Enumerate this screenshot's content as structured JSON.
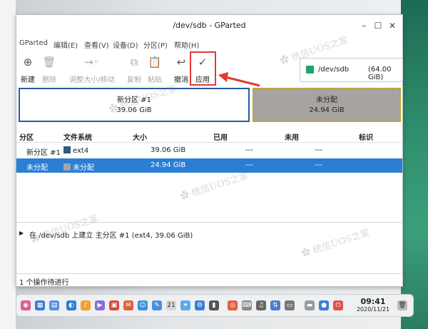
{
  "window": {
    "title": "/dev/sdb - GParted"
  },
  "menubar": [
    "GParted",
    "编辑(E)",
    "查看(V)",
    "设备(D)",
    "分区(P)",
    "帮助(H)"
  ],
  "toolbar": {
    "new": "新建",
    "delete": "删除",
    "resize": "调整大小/移动",
    "copy": "复制",
    "paste": "粘贴",
    "undo": "撤消",
    "apply": "应用"
  },
  "device": {
    "path": "/dev/sdb",
    "size": "(64.00 GiB)"
  },
  "partition_map": [
    {
      "name": "新分区 #1",
      "size": "39.06 GiB"
    },
    {
      "name": "未分配",
      "size": "24.94 GiB"
    }
  ],
  "table": {
    "headers": [
      "分区",
      "文件系统",
      "大小",
      "已用",
      "未用",
      "标识"
    ],
    "rows": [
      {
        "partition": "新分区 #1",
        "fs": "ext4",
        "fs_color": "#315a7e",
        "size": "39.06 GiB",
        "used": "---",
        "unused": "---",
        "flags": ""
      },
      {
        "partition": "未分配",
        "fs": "未分配",
        "fs_color": "#a5a5a5",
        "size": "24.94 GiB",
        "used": "---",
        "unused": "---",
        "flags": ""
      }
    ]
  },
  "operations": [
    "在 /dev/sdb 上建立 主分区 #1 (ext4, 39.06 GiB)"
  ],
  "status": "1 个操作待进行",
  "taskbar": {
    "time": "09:41",
    "date": "2020/11/21"
  },
  "watermark": "统信UOS之家 www.xtuos.com",
  "colors": {
    "highlight": "#e53935",
    "selection": "#2a7fd4",
    "primary_border": "#2c5aa0",
    "unallocated_fill": "#a7a3a0"
  }
}
